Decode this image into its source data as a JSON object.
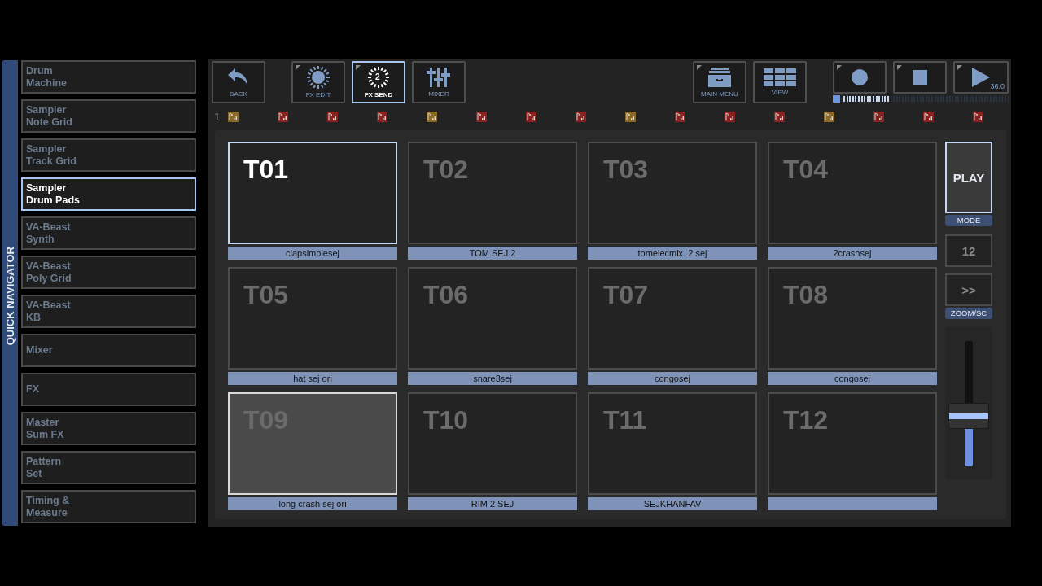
{
  "sidebar": {
    "title": "QUICK NAVIGATOR",
    "items": [
      {
        "label": "Drum\nMachine",
        "selected": false
      },
      {
        "label": "Sampler\nNote Grid",
        "selected": false
      },
      {
        "label": "Sampler\nTrack Grid",
        "selected": false
      },
      {
        "label": "Sampler\nDrum Pads",
        "selected": true
      },
      {
        "label": "VA-Beast\nSynth",
        "selected": false
      },
      {
        "label": "VA-Beast\nPoly Grid",
        "selected": false
      },
      {
        "label": "VA-Beast\nKB",
        "selected": false
      },
      {
        "label": "Mixer",
        "selected": false
      },
      {
        "label": "FX",
        "selected": false
      },
      {
        "label": "Master\nSum FX",
        "selected": false
      },
      {
        "label": "Pattern\nSet",
        "selected": false
      },
      {
        "label": "Timing &\nMeasure",
        "selected": false
      }
    ]
  },
  "toolbar": {
    "buttons": [
      {
        "kind": "back",
        "label": "BACK",
        "has_menu": false,
        "selected": false
      },
      {
        "kind": "fx-edit",
        "label": "FX EDIT",
        "has_menu": true,
        "selected": false
      },
      {
        "kind": "fx-send",
        "label": "FX SEND",
        "badge": "2",
        "has_menu": true,
        "selected": true
      },
      {
        "kind": "mixer",
        "label": "MIXER",
        "has_menu": false,
        "selected": false
      },
      {
        "kind": "main-menu",
        "label": "MAIN MENU",
        "has_menu": true,
        "selected": false
      },
      {
        "kind": "view",
        "label": "VIEW",
        "has_menu": false,
        "selected": false
      }
    ]
  },
  "transport": {
    "buttons": [
      {
        "kind": "record",
        "has_menu": true
      },
      {
        "kind": "stop",
        "has_menu": true
      },
      {
        "kind": "play",
        "has_menu": true,
        "readout": "36.0"
      }
    ],
    "meter": {
      "level": 0.28
    }
  },
  "steps": {
    "pattern": "1",
    "markers": [
      {
        "color": "#8a6a2a"
      },
      {
        "color": "#8a2222"
      },
      {
        "color": "#8a2222"
      },
      {
        "color": "#8a2222"
      },
      {
        "color": "#8a6a2a"
      },
      {
        "color": "#8a2222"
      },
      {
        "color": "#8a2222"
      },
      {
        "color": "#8a2222"
      },
      {
        "color": "#8a6a2a"
      },
      {
        "color": "#8a2222"
      },
      {
        "color": "#8a2222"
      },
      {
        "color": "#8a2222"
      },
      {
        "color": "#8a6a2a"
      },
      {
        "color": "#8a2222"
      },
      {
        "color": "#8a2222"
      },
      {
        "color": "#8a2222"
      }
    ]
  },
  "pads": [
    {
      "name": "T01",
      "sample": "clapsimplesej",
      "selected": true,
      "lit": false
    },
    {
      "name": "T02",
      "sample": "TOM SEJ 2",
      "selected": false,
      "lit": false
    },
    {
      "name": "T03",
      "sample": "tomelecmix  2 sej",
      "selected": false,
      "lit": false
    },
    {
      "name": "T04",
      "sample": "2crashsej",
      "selected": false,
      "lit": false
    },
    {
      "name": "T05",
      "sample": "hat sej ori",
      "selected": false,
      "lit": false
    },
    {
      "name": "T06",
      "sample": "snare3sej",
      "selected": false,
      "lit": false
    },
    {
      "name": "T07",
      "sample": "congosej",
      "selected": false,
      "lit": false
    },
    {
      "name": "T08",
      "sample": "congosej",
      "selected": false,
      "lit": false
    },
    {
      "name": "T09",
      "sample": "long crash sej ori",
      "selected": false,
      "lit": true
    },
    {
      "name": "T10",
      "sample": "RIM 2 SEJ",
      "selected": false,
      "lit": false
    },
    {
      "name": "T11",
      "sample": "SEJKHANFAV",
      "selected": false,
      "lit": false
    },
    {
      "name": "T12",
      "selected": false,
      "lit": false
    }
  ],
  "side_controls": {
    "play_button": "PLAY",
    "mode_label": "MODE",
    "count": "12",
    "scroll_button": ">>",
    "zoom_label": "ZOOM/SC",
    "fader": {
      "level": 0.4
    }
  }
}
